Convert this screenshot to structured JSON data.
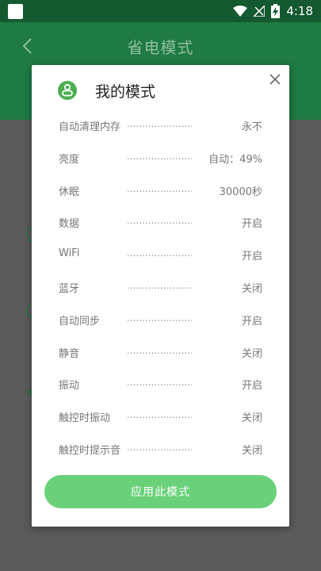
{
  "status_bar": {
    "time": "4:18",
    "icons": [
      "wifi-icon",
      "no-signal-icon",
      "battery-charging-icon"
    ]
  },
  "header": {
    "title": "省电模式"
  },
  "dialog": {
    "title": "我的模式",
    "dots": "......................",
    "settings": [
      {
        "label": "自动清理内存",
        "value": "永不"
      },
      {
        "label": "亮度",
        "value": "自动：49%"
      },
      {
        "label": "休眠",
        "value": "30000秒"
      },
      {
        "label": "数据",
        "value": "开启"
      },
      {
        "label": "WiFi",
        "value": "开启"
      },
      {
        "label": "蓝牙",
        "value": "关闭"
      },
      {
        "label": "自动同步",
        "value": "开启"
      },
      {
        "label": "静音",
        "value": "关闭"
      },
      {
        "label": "振动",
        "value": "开启"
      },
      {
        "label": "触控时振动",
        "value": "关闭"
      },
      {
        "label": "触控时提示音",
        "value": "关闭"
      }
    ],
    "apply_label": "应用此模式"
  },
  "colors": {
    "header_green": "#1f7a43",
    "status_green": "#14592f",
    "accent_green": "#6ad17a",
    "icon_green": "#4caf50"
  }
}
